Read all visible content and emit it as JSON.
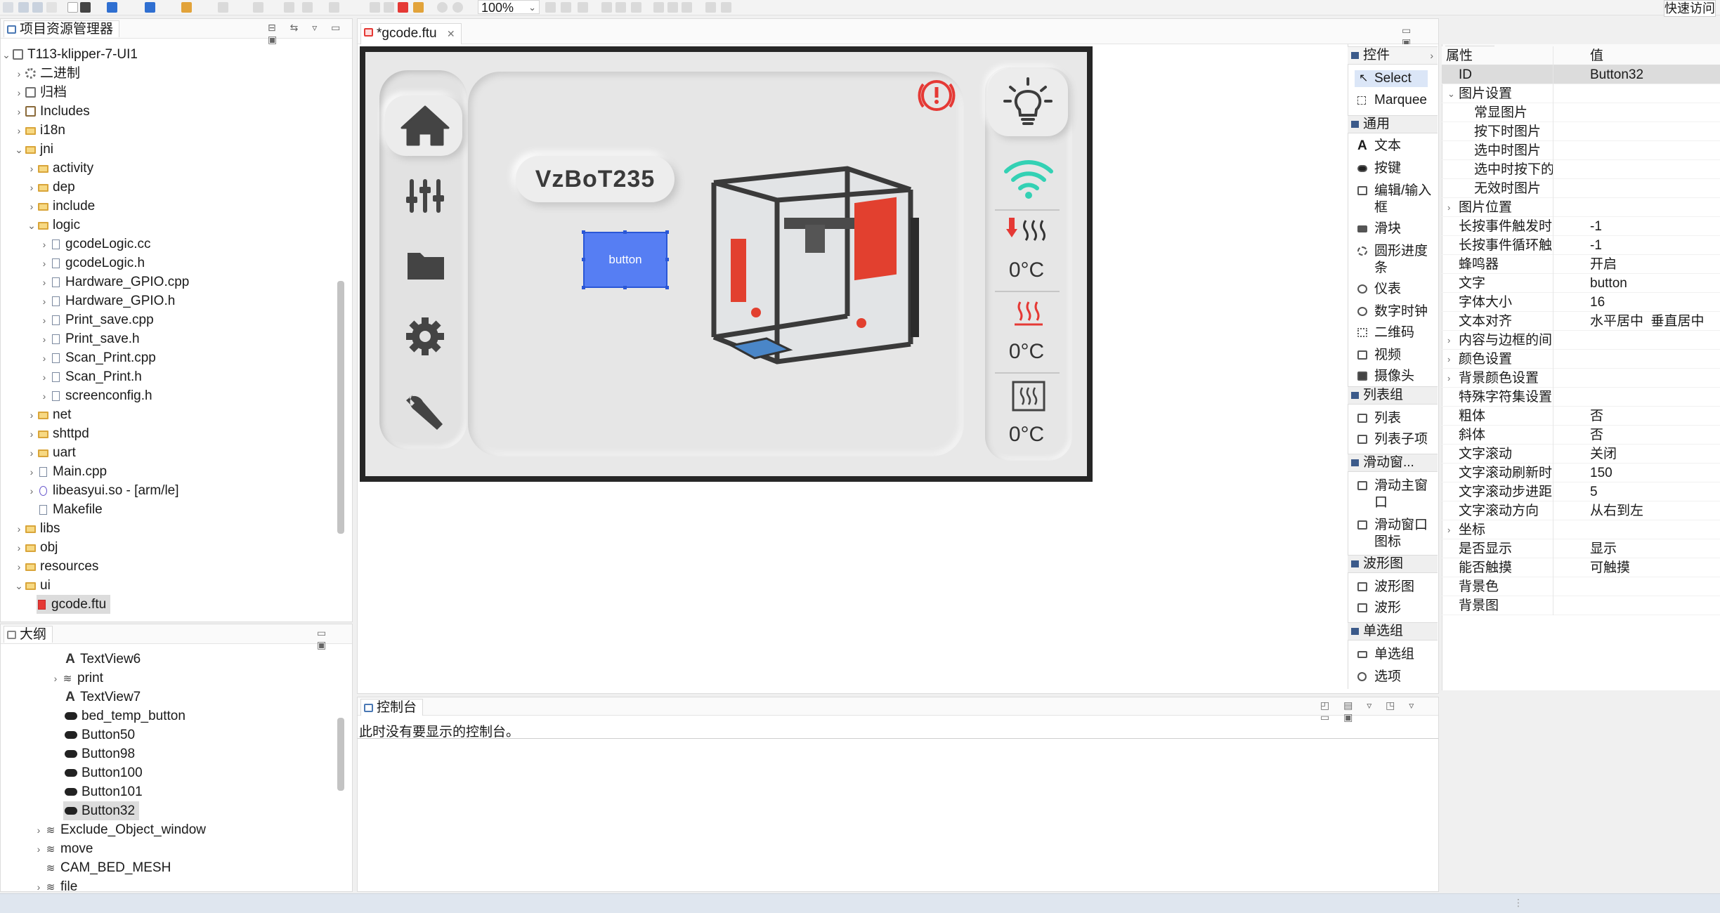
{
  "toolbar": {
    "zoom": "100%",
    "quick_access": "快速访问"
  },
  "project_explorer": {
    "title": "项目资源管理器",
    "items": [
      {
        "label": "T113-klipper-7-UI1"
      },
      {
        "label": "二进制"
      },
      {
        "label": "归档"
      },
      {
        "label": "Includes"
      },
      {
        "label": "i18n"
      },
      {
        "label": "jni"
      },
      {
        "label": "activity"
      },
      {
        "label": "dep"
      },
      {
        "label": "include"
      },
      {
        "label": "logic"
      },
      {
        "label": "gcodeLogic.cc"
      },
      {
        "label": "gcodeLogic.h"
      },
      {
        "label": "Hardware_GPIO.cpp"
      },
      {
        "label": "Hardware_GPIO.h"
      },
      {
        "label": "Print_save.cpp"
      },
      {
        "label": "Print_save.h"
      },
      {
        "label": "Scan_Print.cpp"
      },
      {
        "label": "Scan_Print.h"
      },
      {
        "label": "screenconfig.h"
      },
      {
        "label": "net"
      },
      {
        "label": "shttpd"
      },
      {
        "label": "uart"
      },
      {
        "label": "Main.cpp"
      },
      {
        "label": "libeasyui.so - [arm/le]"
      },
      {
        "label": "Makefile"
      },
      {
        "label": "libs"
      },
      {
        "label": "obj"
      },
      {
        "label": "resources"
      },
      {
        "label": "ui"
      },
      {
        "label": "gcode.ftu"
      }
    ]
  },
  "outline": {
    "title": "大纲",
    "items": [
      {
        "label": "TextView6"
      },
      {
        "label": "print"
      },
      {
        "label": "TextView7"
      },
      {
        "label": "bed_temp_button"
      },
      {
        "label": "Button50"
      },
      {
        "label": "Button98"
      },
      {
        "label": "Button100"
      },
      {
        "label": "Button101"
      },
      {
        "label": "Button32"
      },
      {
        "label": "Exclude_Object_window"
      },
      {
        "label": "move"
      },
      {
        "label": "CAM_BED_MESH"
      },
      {
        "label": "file"
      }
    ]
  },
  "editor": {
    "tab": "*gcode.ftu",
    "device_name": "VzBoT235",
    "button_label": "button",
    "temps": [
      "0°C",
      "0°C",
      "0°C"
    ]
  },
  "palette": {
    "title": "控件",
    "tools": [
      {
        "label": "Select"
      },
      {
        "label": "Marquee"
      }
    ],
    "groups": [
      {
        "title": "通用",
        "items": [
          {
            "label": "文本"
          },
          {
            "label": "按键"
          },
          {
            "label": "编辑/输入框"
          },
          {
            "label": "滑块"
          },
          {
            "label": "圆形进度条"
          },
          {
            "label": "仪表"
          },
          {
            "label": "数字时钟"
          },
          {
            "label": "二维码"
          },
          {
            "label": "视频"
          },
          {
            "label": "摄像头"
          }
        ]
      },
      {
        "title": "列表组",
        "items": [
          {
            "label": "列表"
          },
          {
            "label": "列表子项"
          }
        ]
      },
      {
        "title": "滑动窗...",
        "items": [
          {
            "label": "滑动主窗口"
          },
          {
            "label": "滑动窗口图标"
          }
        ]
      },
      {
        "title": "波形图",
        "items": [
          {
            "label": "波形图"
          },
          {
            "label": "波形"
          }
        ]
      },
      {
        "title": "单选组",
        "items": [
          {
            "label": "单选组"
          },
          {
            "label": "选项"
          }
        ]
      }
    ]
  },
  "properties": {
    "title": "属性",
    "header": {
      "key": "属性",
      "value": "值"
    },
    "rows": [
      {
        "key": "ID",
        "value": "Button32"
      },
      {
        "key": "图片设置",
        "value": ""
      },
      {
        "key": "常显图片",
        "value": ""
      },
      {
        "key": "按下时图片",
        "value": ""
      },
      {
        "key": "选中时图片",
        "value": ""
      },
      {
        "key": "选中时按下的",
        "value": ""
      },
      {
        "key": "无效时图片",
        "value": ""
      },
      {
        "key": "图片位置",
        "value": ""
      },
      {
        "key": "长按事件触发时",
        "value": "-1"
      },
      {
        "key": "长按事件循环触",
        "value": "-1"
      },
      {
        "key": "蜂鸣器",
        "value": "开启"
      },
      {
        "key": "文字",
        "value": "button"
      },
      {
        "key": "字体大小",
        "value": "16"
      },
      {
        "key": "文本对齐",
        "value": "水平居中  垂直居中"
      },
      {
        "key": "内容与边框的间",
        "value": ""
      },
      {
        "key": "颜色设置",
        "value": ""
      },
      {
        "key": "背景颜色设置",
        "value": ""
      },
      {
        "key": "特殊字符集设置",
        "value": ""
      },
      {
        "key": "粗体",
        "value": "否"
      },
      {
        "key": "斜体",
        "value": "否"
      },
      {
        "key": "文字滚动",
        "value": "关闭"
      },
      {
        "key": "文字滚动刷新时",
        "value": "150"
      },
      {
        "key": "文字滚动步进距",
        "value": "5"
      },
      {
        "key": "文字滚动方向",
        "value": "从右到左"
      },
      {
        "key": "坐标",
        "value": ""
      },
      {
        "key": "是否显示",
        "value": "显示"
      },
      {
        "key": "能否触摸",
        "value": "可触摸"
      },
      {
        "key": "背景色",
        "value": ""
      },
      {
        "key": "背景图",
        "value": ""
      }
    ]
  },
  "console": {
    "title": "控制台",
    "message": "此时没有要显示的控制台。"
  },
  "colors": {
    "accent": "#567ef3",
    "wifi": "#33d1b4",
    "warning": "#e53935"
  }
}
